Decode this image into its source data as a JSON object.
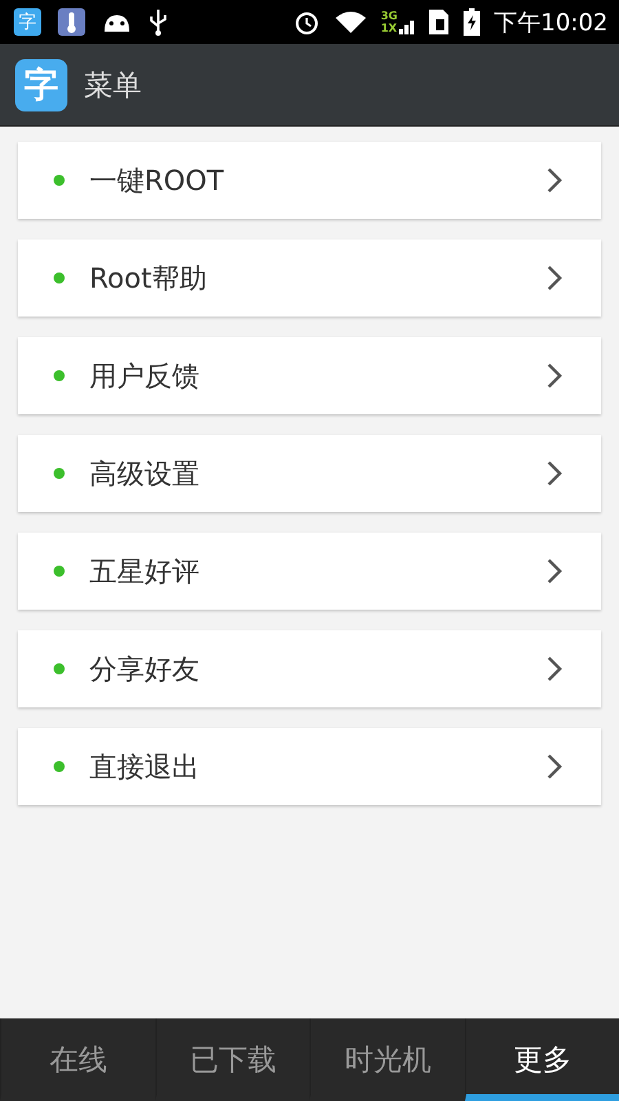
{
  "status_bar": {
    "app_glyph": "字",
    "network": [
      "3G",
      "1X"
    ],
    "time": "下午10:02"
  },
  "app_bar": {
    "logo_glyph": "字",
    "title": "菜单"
  },
  "menu_items": [
    {
      "label": "一键ROOT"
    },
    {
      "label": "Root帮助"
    },
    {
      "label": "用户反馈"
    },
    {
      "label": "高级设置"
    },
    {
      "label": "五星好评"
    },
    {
      "label": "分享好友"
    },
    {
      "label": "直接退出"
    }
  ],
  "tabs": [
    {
      "label": "在线",
      "selected": false
    },
    {
      "label": "已下载",
      "selected": false
    },
    {
      "label": "时光机",
      "selected": false
    },
    {
      "label": "更多",
      "selected": true
    }
  ]
}
